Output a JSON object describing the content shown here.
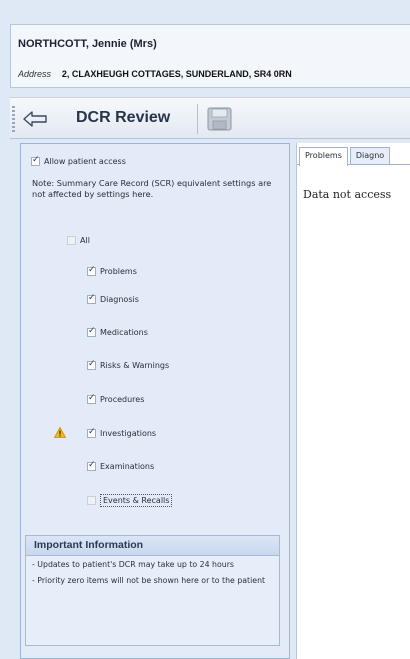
{
  "patient": {
    "name": "NORTHCOTT, Jennie (Mrs)",
    "address_label": "Address",
    "address_value": "2, CLAXHEUGH COTTAGES, SUNDERLAND, SR4 0RN"
  },
  "toolbar": {
    "title": "DCR Review"
  },
  "left_panel": {
    "allow_label": "Allow patient access",
    "allow_checked": true,
    "note": "Note: Summary Care Record (SCR) equivalent settings are not affected by settings here.",
    "all_label": "All",
    "options": [
      {
        "label": "Problems",
        "checked": true
      },
      {
        "label": "Diagnosis",
        "checked": true
      },
      {
        "label": "Medications",
        "checked": true
      },
      {
        "label": "Risks & Warnings",
        "checked": true
      },
      {
        "label": "Procedures",
        "checked": true
      },
      {
        "label": "Investigations",
        "checked": true
      },
      {
        "label": "Examinations",
        "checked": true
      },
      {
        "label": "Events & Recalls",
        "checked": false
      }
    ],
    "info": {
      "title": "Important Information",
      "items": [
        "- Updates to patient's DCR may take up to 24 hours",
        "- Priority zero items will not be shown here or to the patient"
      ]
    }
  },
  "right_pane": {
    "tabs": [
      "Problems",
      "Diagno"
    ],
    "message": "Data not access"
  }
}
